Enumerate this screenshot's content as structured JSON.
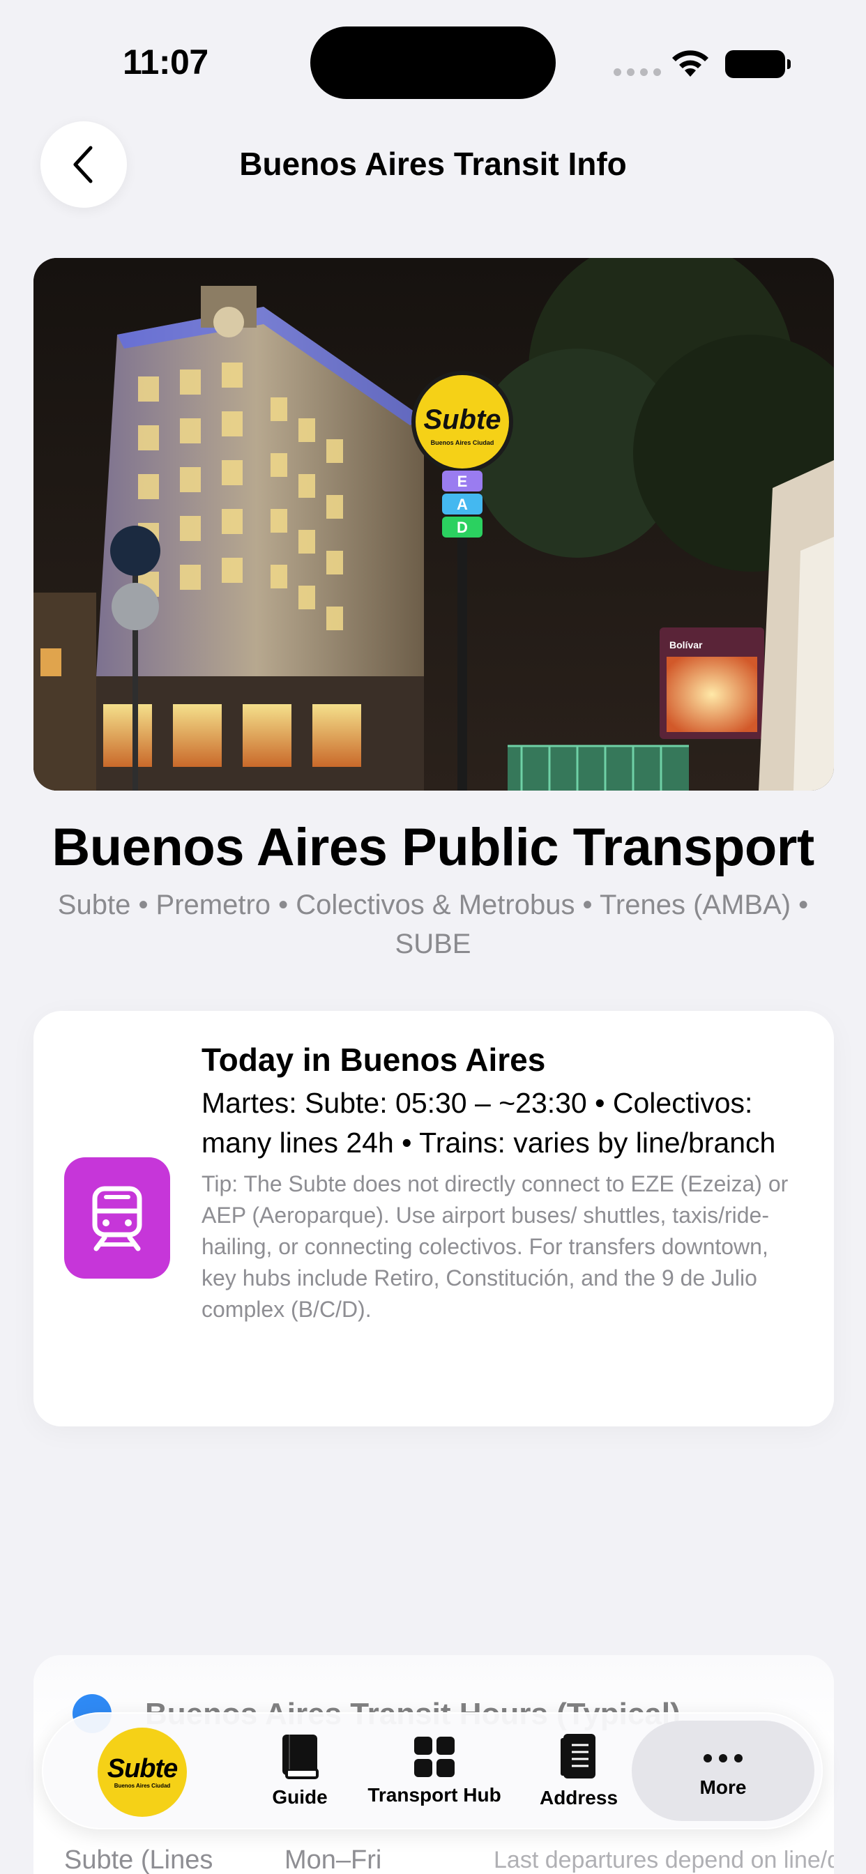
{
  "status": {
    "time": "11:07"
  },
  "nav": {
    "title": "Buenos Aires Transit Info"
  },
  "hero": {
    "sign_text": "Subte",
    "sign_sub": "Buenos Aires Ciudad",
    "lines": [
      "E",
      "A",
      "D"
    ],
    "billboard": "Bolívar"
  },
  "headline": "Buenos Aires Public Transport",
  "subline": "Subte • Premetro • Colectivos & Metrobus • Trenes (AMBA) • SUBE",
  "today": {
    "title": "Today in Buenos Aires",
    "body": "Martes: Subte: 05:30 – ~23:30 • Colectivos: many lines 24h • Trains: varies by line/branch",
    "tip": "Tip: The Subte does not directly connect to EZE (Ezeiza) or AEP (Aeroparque). Use airport buses/ shuttles, taxis/ride-hailing, or connecting colectivos. For transfers downtown, key hubs include Retiro, Constitución, and the 9 de Julio complex (B/C/D)."
  },
  "lower_card": {
    "title": "Buenos Aires Transit Hours (Typical)",
    "col1": "Subte (Lines",
    "col2": "Mon–Fri",
    "col3": "Last departures depend on line/direction"
  },
  "tabbar": {
    "logo_word": "Subte",
    "logo_sub": "Buenos Aires Ciudad",
    "items": [
      {
        "label": "Guide",
        "icon": "book-icon"
      },
      {
        "label": "Transport Hub",
        "icon": "grid-icon"
      },
      {
        "label": "Address",
        "icon": "notebook-icon"
      },
      {
        "label": "More",
        "icon": "ellipsis-icon"
      }
    ]
  },
  "colors": {
    "accent_purple": "#c636d9",
    "subte_yellow": "#f5d117",
    "background": "#f2f2f6",
    "muted": "#8e8e93"
  }
}
